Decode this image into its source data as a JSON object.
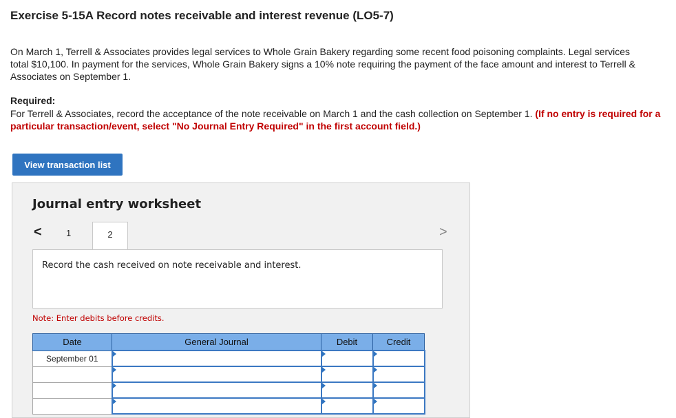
{
  "header": {
    "title": "Exercise 5-15A Record notes receivable and interest revenue (LO5-7)"
  },
  "problem": {
    "text": "On March 1, Terrell & Associates provides legal services to Whole Grain Bakery regarding some recent food poisoning complaints. Legal services total $10,100. In payment for the services, Whole Grain Bakery signs a 10% note requiring the payment of the face amount and interest to Terrell & Associates on September 1.",
    "required_label": "Required:",
    "required_text": "For Terrell & Associates, record the acceptance of the note receivable on March 1 and the cash collection on September 1.",
    "required_note": "(If no entry is required for a particular transaction/event, select \"No Journal Entry Required\" in the first account field.)"
  },
  "buttons": {
    "view_transactions": "View transaction list"
  },
  "worksheet": {
    "title": "Journal entry worksheet",
    "prev_glyph": "<",
    "next_glyph": ">",
    "tabs": [
      "1",
      "2"
    ],
    "active_tab": "2",
    "instruction": "Record the cash received on note receivable and interest.",
    "note": "Note: Enter debits before credits.",
    "columns": {
      "date": "Date",
      "general_journal": "General Journal",
      "debit": "Debit",
      "credit": "Credit"
    },
    "rows": [
      {
        "date": "September 01",
        "account": "",
        "debit": "",
        "credit": ""
      },
      {
        "date": "",
        "account": "",
        "debit": "",
        "credit": ""
      },
      {
        "date": "",
        "account": "",
        "debit": "",
        "credit": ""
      },
      {
        "date": "",
        "account": "",
        "debit": "",
        "credit": ""
      }
    ]
  },
  "colors": {
    "accent": "#2f74c0",
    "table_header": "#7aaee8",
    "required_red": "#c00000"
  }
}
